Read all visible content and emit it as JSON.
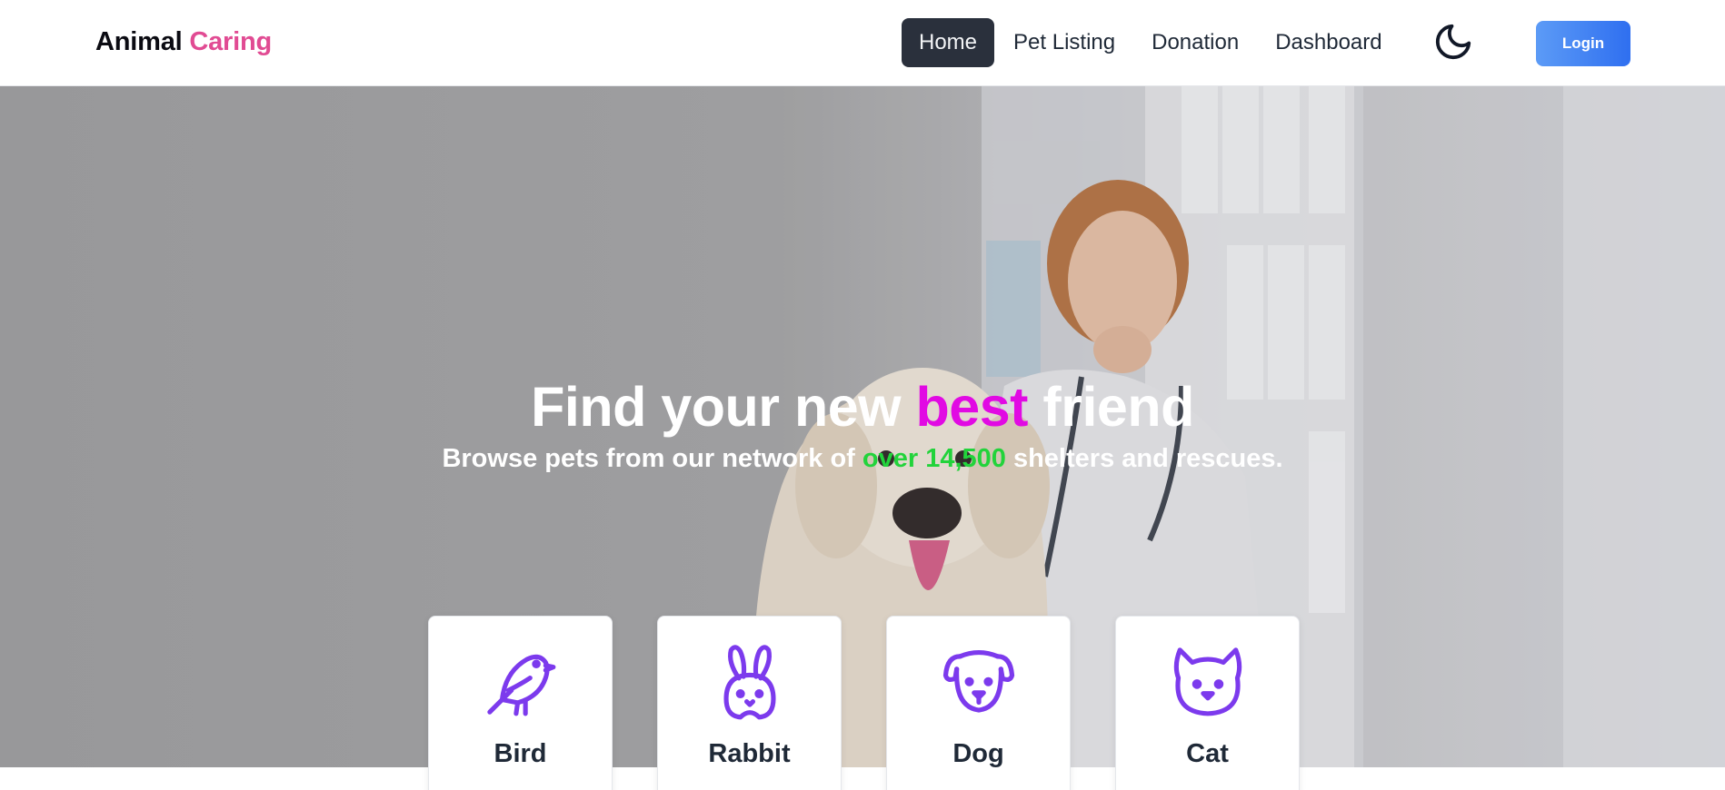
{
  "brand": {
    "first": "Animal",
    "second": "Caring",
    "accent_color": "#e14b93"
  },
  "nav": {
    "links": [
      {
        "label": "Home",
        "active": true
      },
      {
        "label": "Pet Listing",
        "active": false
      },
      {
        "label": "Donation",
        "active": false
      },
      {
        "label": "Dashboard",
        "active": false
      }
    ],
    "theme_icon": "moon-icon",
    "login_label": "Login"
  },
  "hero": {
    "title_before": "Find your new ",
    "title_highlight": "best",
    "title_after": " friend",
    "subtitle_before": "Browse pets from our network of ",
    "subtitle_highlight": "over 14,500",
    "subtitle_after": " shelters and rescues.",
    "highlight_color": "#e10ae3",
    "green_color": "#22d33b"
  },
  "categories": [
    {
      "label": "Bird",
      "icon": "bird-icon"
    },
    {
      "label": "Rabbit",
      "icon": "rabbit-icon"
    },
    {
      "label": "Dog",
      "icon": "dog-icon"
    },
    {
      "label": "Cat",
      "icon": "cat-icon"
    }
  ],
  "icon_color": "#7c3aed"
}
